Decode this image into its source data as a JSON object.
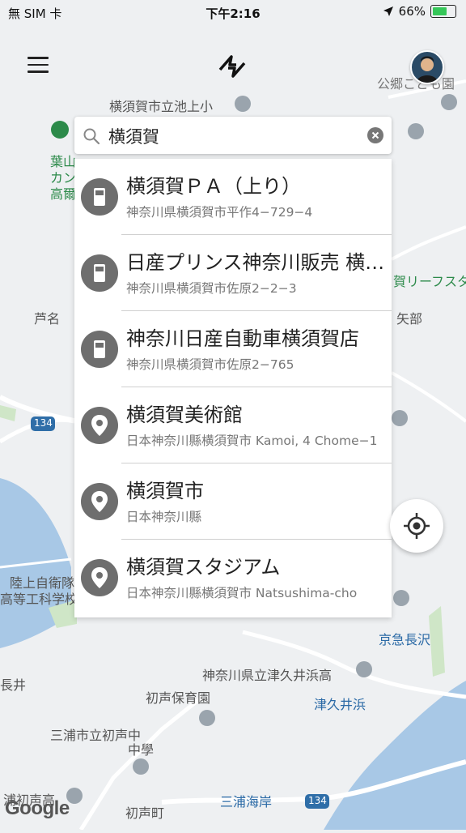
{
  "status_bar": {
    "carrier": "無 SIM 卡",
    "time": "下午2:16",
    "battery": "66%",
    "battery_level": 0.66
  },
  "header": {
    "menu_icon": "hamburger-icon",
    "logo_icon": "lightning-logo-icon",
    "avatar_icon": "user-avatar"
  },
  "search": {
    "value": "横須賀",
    "search_icon": "search-icon",
    "clear_icon": "clear-icon"
  },
  "results": [
    {
      "title": "横須賀ＰＡ（上り）",
      "subtitle": "神奈川県横須賀市平作4−729−4",
      "icon": "gas-station-icon"
    },
    {
      "title": "日産プリンス神奈川販売 横須賀店",
      "subtitle": "神奈川県横須賀市佐原2−2−3",
      "icon": "gas-station-icon"
    },
    {
      "title": "神奈川日産自動車横須賀店",
      "subtitle": "神奈川県横須賀市佐原2−765",
      "icon": "gas-station-icon"
    },
    {
      "title": "横須賀美術館",
      "subtitle": "日本神奈川縣横須賀市 Kamoi, 4 Chome−1",
      "icon": "location-pin-icon"
    },
    {
      "title": "横須賀市",
      "subtitle": "日本神奈川縣",
      "icon": "location-pin-icon"
    },
    {
      "title": "横須賀スタジアム",
      "subtitle": "日本神奈川縣横須賀市 Natsushima-cho",
      "icon": "location-pin-icon"
    }
  ],
  "map": {
    "labels": {
      "koyama": "公郷こども園",
      "ikegami": "横須賀市立池上小",
      "hayama_1": "葉山",
      "hayama_2": "カン",
      "hayama_3": "高爾",
      "ashina": "芦名",
      "yabe": "矢部",
      "reef": "賀リーフスタ",
      "route134a": "134",
      "route134b": "134",
      "rikujo1": "陸上自衛隊",
      "rikujo2": "高等工科学校",
      "keikyu": "京急長沢",
      "tsukui_hs": "神奈川県立津久井浜高",
      "hatsukoe_nursery": "初声保育園",
      "tsukuihama": "津久井浜",
      "miura_hatsukoe_jh1": "三浦市立初声中",
      "miura_hatsukoe_jh2": "中學",
      "nagai": "長井",
      "hatsukoe_elem": "浦初声高",
      "hatsukoe_town": "初声町",
      "miura_kaigan": "三浦海岸",
      "google": "Google"
    }
  },
  "locate_button_icon": "my-location-icon",
  "colors": {
    "water": "#a8c8e6",
    "land": "#eef0f2",
    "road": "#ffffff",
    "green": "#cfe6c7",
    "pin": "#6e6e6e",
    "battery_fill": "#35c759"
  }
}
